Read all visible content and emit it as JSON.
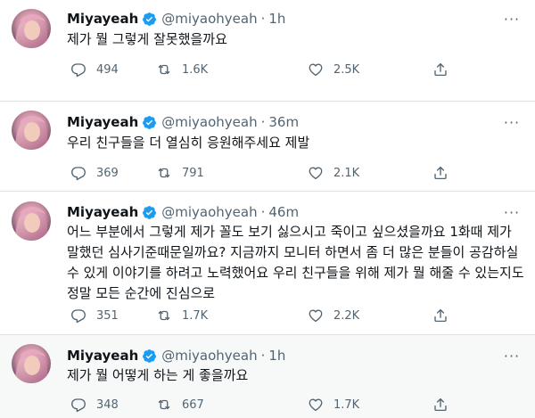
{
  "tweets": [
    {
      "name": "Miyayeah",
      "handle": "@miyaohyeah",
      "dot": "·",
      "time": "1h",
      "more": "···",
      "text": "제가 뭘 그렇게 잘못했을까요",
      "replies": "494",
      "retweets": "1.6K",
      "likes": "2.5K"
    },
    {
      "name": "Miyayeah",
      "handle": "@miyaohyeah",
      "dot": "·",
      "time": "36m",
      "more": "···",
      "text": "우리 친구들을 더 열심히 응원해주세요 제발",
      "replies": "369",
      "retweets": "791",
      "likes": "2.1K"
    },
    {
      "name": "Miyayeah",
      "handle": "@miyaohyeah",
      "dot": "·",
      "time": "46m",
      "more": "···",
      "text": "어느 부분에서 그렇게 제가 꼴도 보기 싫으시고 죽이고 싶으셨을까요 1화때 제가 말했던 심사기준때문일까요? 지금까지 모니터 하면서 좀 더 많은 분들이 공감하실 수 있게 이야기를 하려고 노력했어요 우리 친구들을 위해 제가 뭘 해줄 수 있는지도 정말 모든 순간에 진심으로",
      "replies": "351",
      "retweets": "1.7K",
      "likes": "2.2K"
    },
    {
      "name": "Miyayeah",
      "handle": "@miyaohyeah",
      "dot": "·",
      "time": "1h",
      "more": "···",
      "text": "제가 뭘 어떻게 하는 게 좋을까요",
      "replies": "348",
      "retweets": "667",
      "likes": "1.7K"
    }
  ],
  "colors": {
    "verified": "#1d9bf0",
    "secondary_text": "#536471",
    "highlight_bg": "#f7f9f9"
  },
  "icons": [
    "verified-badge-icon",
    "more-options-icon",
    "reply-icon",
    "retweet-icon",
    "like-icon",
    "share-icon",
    "avatar-image"
  ]
}
